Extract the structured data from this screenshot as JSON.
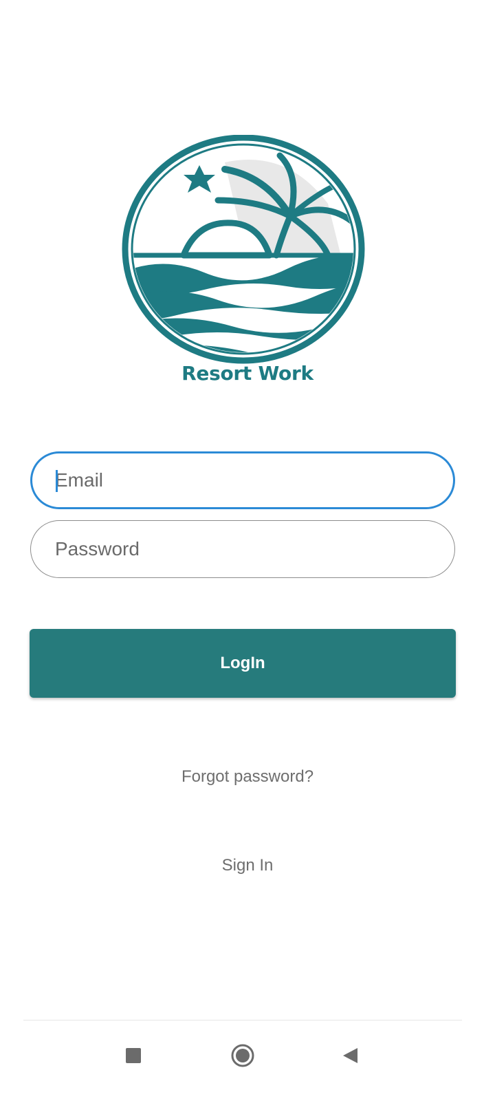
{
  "app": {
    "brand_name": "Resort Work",
    "accent_color": "#267b7c",
    "logo_color": "#1e7b83",
    "logo_icon": "resort-wave-palm-star-logo"
  },
  "login_form": {
    "email": {
      "placeholder": "Email",
      "value": "",
      "focused": true
    },
    "password": {
      "placeholder": "Password",
      "value": ""
    },
    "login_button_label": "LogIn",
    "forgot_password_label": "Forgot password?",
    "sign_in_label": "Sign In"
  },
  "system_nav": {
    "recents_icon": "square-icon",
    "home_icon": "circle-icon",
    "back_icon": "triangle-back-icon"
  }
}
